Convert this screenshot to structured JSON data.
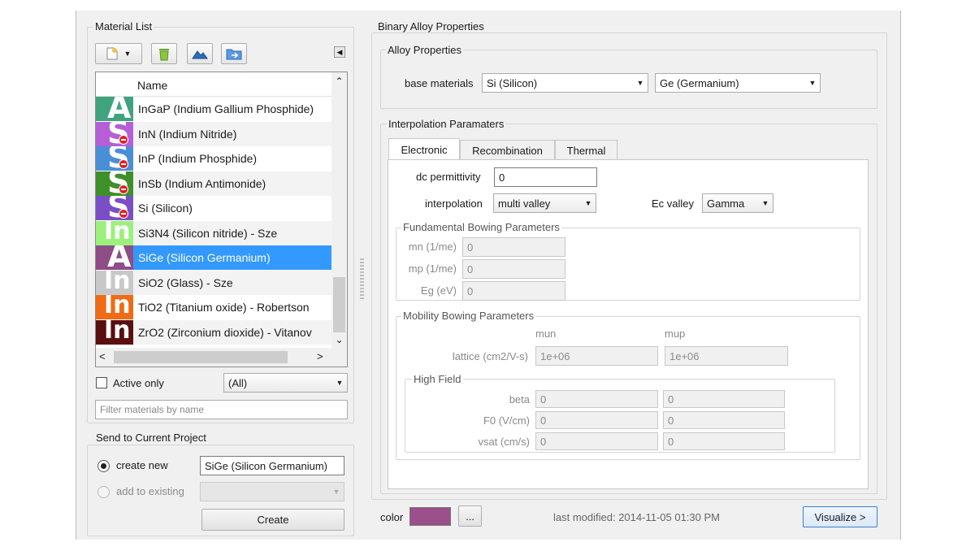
{
  "material_list": {
    "title": "Material List",
    "column_header": "Name",
    "rows": [
      {
        "name": "InGaP (Indium Gallium Phosphide)",
        "color": "#3fa37e",
        "letter": "A",
        "stop": false
      },
      {
        "name": "InN (Indium Nitride)",
        "color": "#b55ed8",
        "letter": "S",
        "stop": true
      },
      {
        "name": "InP (Indium Phosphide)",
        "color": "#4a8fd6",
        "letter": "S",
        "stop": true
      },
      {
        "name": "InSb (Indium Antimonide)",
        "color": "#3f8f2a",
        "letter": "S",
        "stop": true
      },
      {
        "name": "Si (Silicon)",
        "color": "#7a4fc6",
        "letter": "S",
        "stop": true
      },
      {
        "name": "Si3N4 (Silicon nitride) - Sze",
        "color": "#9df07c",
        "letter": "In",
        "stop": false
      },
      {
        "name": "SiGe (Silicon Germanium)",
        "color": "#8e4d86",
        "letter": "A",
        "stop": false
      },
      {
        "name": "SiO2 (Glass) - Sze",
        "color": "#c8c8c8",
        "letter": "In",
        "stop": false
      },
      {
        "name": "TiO2 (Titanium oxide) - Robertson",
        "color": "#f06b16",
        "letter": "In",
        "stop": false
      },
      {
        "name": "ZrO2 (Zirconium dioxide) - Vitanov",
        "color": "#5a0e0e",
        "letter": "In",
        "stop": false
      }
    ],
    "active_only_label": "Active only",
    "filter_combo": "(All)",
    "filter_placeholder": "Filter materials by name"
  },
  "send_project": {
    "title": "Send to Current Project",
    "create_new_label": "create new",
    "create_new_value": "SiGe (Silicon Germanium)",
    "add_existing_label": "add to existing",
    "create_button": "Create"
  },
  "binary": {
    "title": "Binary Alloy Properties",
    "alloy_title": "Alloy Properties",
    "base_materials_label": "base materials",
    "base_material_1": "Si (Silicon)",
    "base_material_2": "Ge (Germanium)",
    "interp_title": "Interpolation Paramaters",
    "tabs": [
      "Electronic",
      "Recombination",
      "Thermal"
    ],
    "dc_label": "dc permittivity",
    "dc_value": "0",
    "interp_label": "interpolation",
    "interp_value": "multi valley",
    "ec_label": "Ec valley",
    "ec_value": "Gamma",
    "fund_title": "Fundamental Bowing Parameters",
    "fund_rows": [
      {
        "label": "mn (1/me)",
        "value": "0"
      },
      {
        "label": "mp (1/me)",
        "value": "0"
      },
      {
        "label": "Eg (eV)",
        "value": "0"
      }
    ],
    "mob_title": "Mobility Bowing Parameters",
    "mun_header": "mun",
    "mup_header": "mup",
    "lattice_label": "lattice (cm2/V-s)",
    "lattice_mun": "1e+06",
    "lattice_mup": "1e+06",
    "hf_title": "High Field",
    "hf_rows": [
      {
        "label": "beta",
        "mun": "0",
        "mup": "0"
      },
      {
        "label": "F0 (V/cm)",
        "mun": "0",
        "mup": "0"
      },
      {
        "label": "vsat (cm/s)",
        "mun": "0",
        "mup": "0"
      }
    ]
  },
  "footer": {
    "color_label": "color",
    "color_value": "#9b4f8b",
    "dots_label": "...",
    "last_modified": "last modified: 2014-11-05 01:30 PM",
    "visualize_button": "Visualize >"
  }
}
